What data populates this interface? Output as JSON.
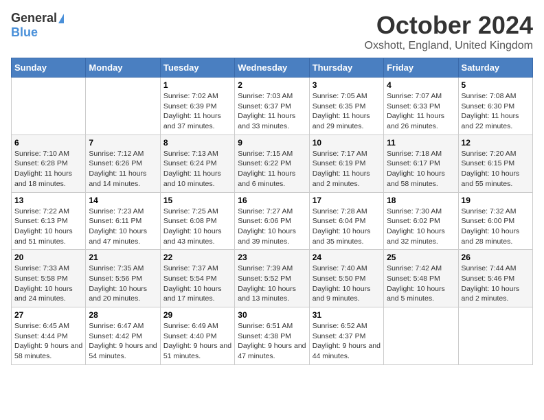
{
  "logo": {
    "general": "General",
    "blue": "Blue"
  },
  "header": {
    "month": "October 2024",
    "location": "Oxshott, England, United Kingdom"
  },
  "weekdays": [
    "Sunday",
    "Monday",
    "Tuesday",
    "Wednesday",
    "Thursday",
    "Friday",
    "Saturday"
  ],
  "weeks": [
    [
      {
        "day": "",
        "info": ""
      },
      {
        "day": "",
        "info": ""
      },
      {
        "day": "1",
        "info": "Sunrise: 7:02 AM\nSunset: 6:39 PM\nDaylight: 11 hours and 37 minutes."
      },
      {
        "day": "2",
        "info": "Sunrise: 7:03 AM\nSunset: 6:37 PM\nDaylight: 11 hours and 33 minutes."
      },
      {
        "day": "3",
        "info": "Sunrise: 7:05 AM\nSunset: 6:35 PM\nDaylight: 11 hours and 29 minutes."
      },
      {
        "day": "4",
        "info": "Sunrise: 7:07 AM\nSunset: 6:33 PM\nDaylight: 11 hours and 26 minutes."
      },
      {
        "day": "5",
        "info": "Sunrise: 7:08 AM\nSunset: 6:30 PM\nDaylight: 11 hours and 22 minutes."
      }
    ],
    [
      {
        "day": "6",
        "info": "Sunrise: 7:10 AM\nSunset: 6:28 PM\nDaylight: 11 hours and 18 minutes."
      },
      {
        "day": "7",
        "info": "Sunrise: 7:12 AM\nSunset: 6:26 PM\nDaylight: 11 hours and 14 minutes."
      },
      {
        "day": "8",
        "info": "Sunrise: 7:13 AM\nSunset: 6:24 PM\nDaylight: 11 hours and 10 minutes."
      },
      {
        "day": "9",
        "info": "Sunrise: 7:15 AM\nSunset: 6:22 PM\nDaylight: 11 hours and 6 minutes."
      },
      {
        "day": "10",
        "info": "Sunrise: 7:17 AM\nSunset: 6:19 PM\nDaylight: 11 hours and 2 minutes."
      },
      {
        "day": "11",
        "info": "Sunrise: 7:18 AM\nSunset: 6:17 PM\nDaylight: 10 hours and 58 minutes."
      },
      {
        "day": "12",
        "info": "Sunrise: 7:20 AM\nSunset: 6:15 PM\nDaylight: 10 hours and 55 minutes."
      }
    ],
    [
      {
        "day": "13",
        "info": "Sunrise: 7:22 AM\nSunset: 6:13 PM\nDaylight: 10 hours and 51 minutes."
      },
      {
        "day": "14",
        "info": "Sunrise: 7:23 AM\nSunset: 6:11 PM\nDaylight: 10 hours and 47 minutes."
      },
      {
        "day": "15",
        "info": "Sunrise: 7:25 AM\nSunset: 6:08 PM\nDaylight: 10 hours and 43 minutes."
      },
      {
        "day": "16",
        "info": "Sunrise: 7:27 AM\nSunset: 6:06 PM\nDaylight: 10 hours and 39 minutes."
      },
      {
        "day": "17",
        "info": "Sunrise: 7:28 AM\nSunset: 6:04 PM\nDaylight: 10 hours and 35 minutes."
      },
      {
        "day": "18",
        "info": "Sunrise: 7:30 AM\nSunset: 6:02 PM\nDaylight: 10 hours and 32 minutes."
      },
      {
        "day": "19",
        "info": "Sunrise: 7:32 AM\nSunset: 6:00 PM\nDaylight: 10 hours and 28 minutes."
      }
    ],
    [
      {
        "day": "20",
        "info": "Sunrise: 7:33 AM\nSunset: 5:58 PM\nDaylight: 10 hours and 24 minutes."
      },
      {
        "day": "21",
        "info": "Sunrise: 7:35 AM\nSunset: 5:56 PM\nDaylight: 10 hours and 20 minutes."
      },
      {
        "day": "22",
        "info": "Sunrise: 7:37 AM\nSunset: 5:54 PM\nDaylight: 10 hours and 17 minutes."
      },
      {
        "day": "23",
        "info": "Sunrise: 7:39 AM\nSunset: 5:52 PM\nDaylight: 10 hours and 13 minutes."
      },
      {
        "day": "24",
        "info": "Sunrise: 7:40 AM\nSunset: 5:50 PM\nDaylight: 10 hours and 9 minutes."
      },
      {
        "day": "25",
        "info": "Sunrise: 7:42 AM\nSunset: 5:48 PM\nDaylight: 10 hours and 5 minutes."
      },
      {
        "day": "26",
        "info": "Sunrise: 7:44 AM\nSunset: 5:46 PM\nDaylight: 10 hours and 2 minutes."
      }
    ],
    [
      {
        "day": "27",
        "info": "Sunrise: 6:45 AM\nSunset: 4:44 PM\nDaylight: 9 hours and 58 minutes."
      },
      {
        "day": "28",
        "info": "Sunrise: 6:47 AM\nSunset: 4:42 PM\nDaylight: 9 hours and 54 minutes."
      },
      {
        "day": "29",
        "info": "Sunrise: 6:49 AM\nSunset: 4:40 PM\nDaylight: 9 hours and 51 minutes."
      },
      {
        "day": "30",
        "info": "Sunrise: 6:51 AM\nSunset: 4:38 PM\nDaylight: 9 hours and 47 minutes."
      },
      {
        "day": "31",
        "info": "Sunrise: 6:52 AM\nSunset: 4:37 PM\nDaylight: 9 hours and 44 minutes."
      },
      {
        "day": "",
        "info": ""
      },
      {
        "day": "",
        "info": ""
      }
    ]
  ]
}
